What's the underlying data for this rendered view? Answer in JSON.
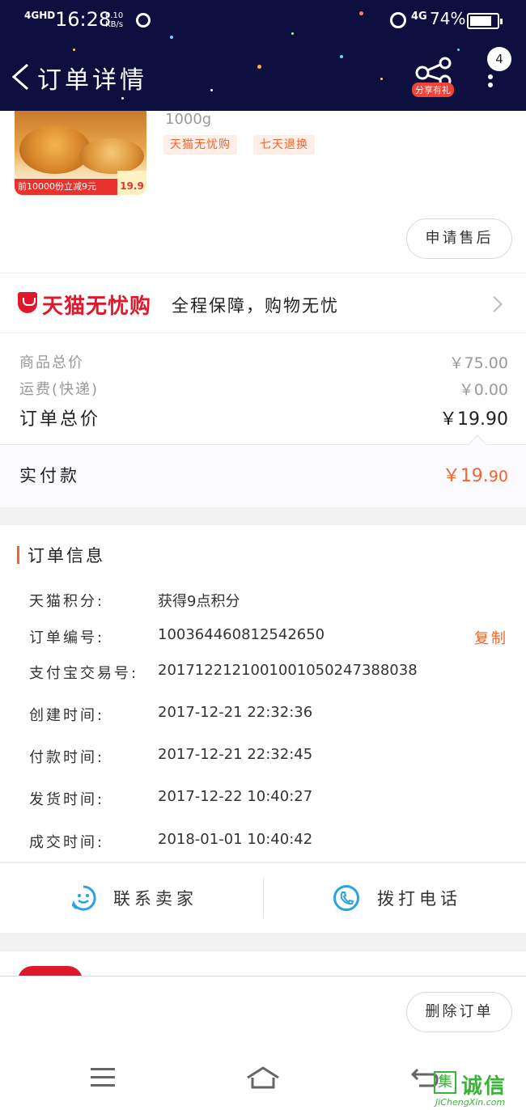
{
  "colors": {
    "header_bg": "#0d0f3f",
    "accent": "#f2642e",
    "tmall_red": "#e0182c",
    "link_blue": "#2aa4e0"
  },
  "status_bar": {
    "signal": "4GHD",
    "time": "16:28",
    "speed_value": "0.10",
    "speed_unit": "KB/s",
    "network": "4G",
    "battery_percent": "74%",
    "battery_level": 0.74
  },
  "nav": {
    "title": "订单详情",
    "share_label": "分享有礼",
    "message_count": "4"
  },
  "product": {
    "promo_text": "前10000份立减9元",
    "promo_price": "19.9",
    "spec": "1000g",
    "tags": [
      "天猫无忧购",
      "七天退换"
    ],
    "after_sale_button": "申请售后"
  },
  "guarantee": {
    "brand": "天猫无忧购",
    "slogan": "全程保障，购物无忧"
  },
  "prices": {
    "goods_total_label": "商品总价",
    "goods_total_value": "￥75.00",
    "shipping_label": "运费(快递)",
    "shipping_value": "￥0.00",
    "order_total_label": "订单总价",
    "order_total_value": "￥19.90",
    "paid_label": "实付款",
    "paid_value_main": "￥19.",
    "paid_value_decimal": "90"
  },
  "order_info": {
    "title": "订单信息",
    "copy_label": "复制",
    "rows": [
      {
        "key": "天猫积分:",
        "value": "获得9点积分"
      },
      {
        "key": "订单编号:",
        "value": "100364460812542650"
      },
      {
        "key": "支付宝交易号:",
        "value": "2017122121001001050247388038"
      },
      {
        "key": "创建时间:",
        "value": "2017-12-21 22:32:36"
      },
      {
        "key": "付款时间:",
        "value": "2017-12-21 22:32:45"
      },
      {
        "key": "发货时间:",
        "value": "2017-12-22 10:40:27"
      },
      {
        "key": "成交时间:",
        "value": "2018-01-01 10:40:42"
      }
    ]
  },
  "contact": {
    "seller_label": "联系卖家",
    "phone_label": "拨打电话"
  },
  "footer": {
    "delete_button": "删除订单"
  },
  "watermark": {
    "logo_char": "集",
    "text_cn": "诚信",
    "text_en": "JiChengXin.com"
  }
}
